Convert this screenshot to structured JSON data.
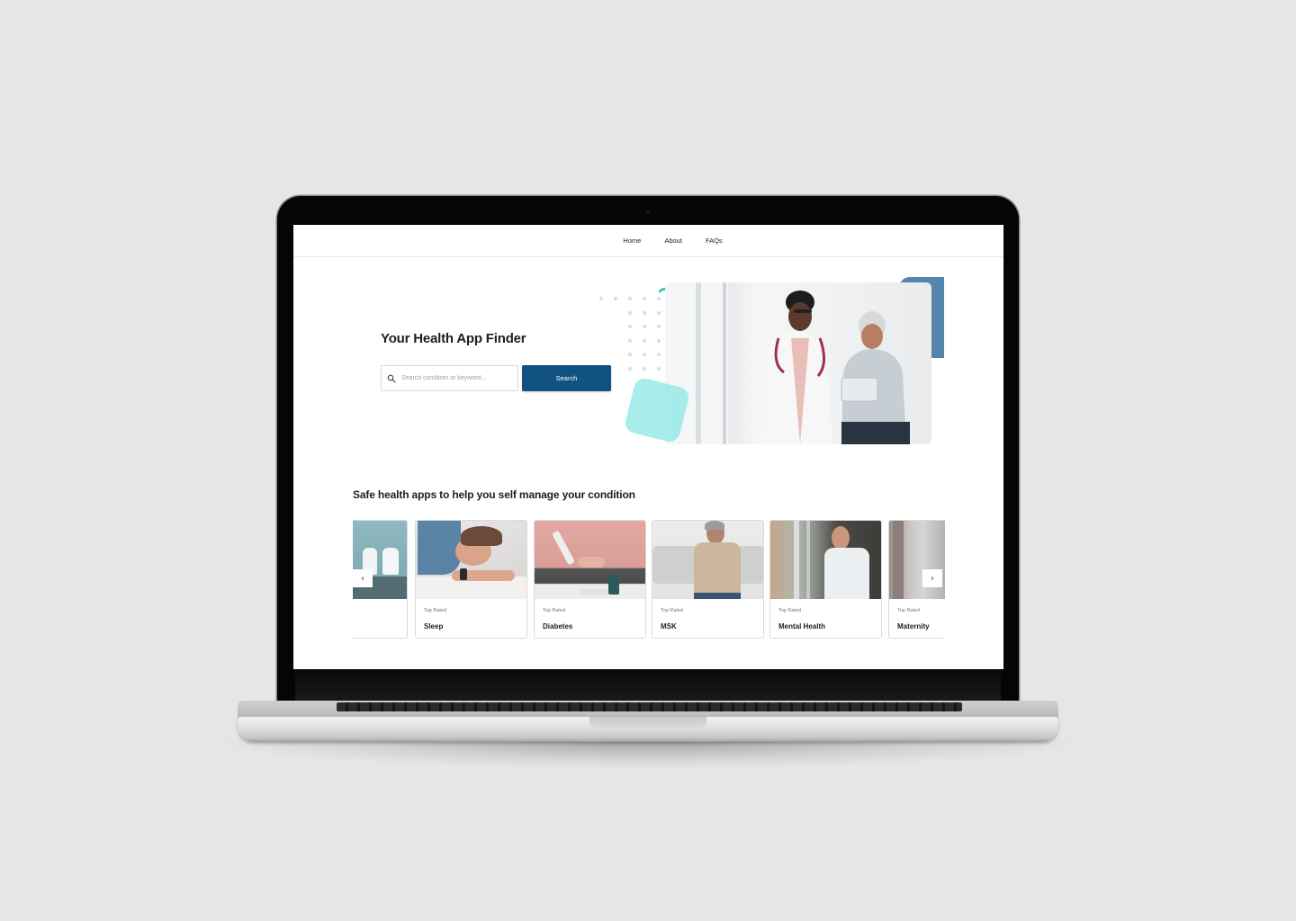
{
  "nav": {
    "items": [
      {
        "label": "Home"
      },
      {
        "label": "About"
      },
      {
        "label": "FAQs"
      }
    ]
  },
  "hero": {
    "title": "Your Health App Finder",
    "search_placeholder": "Search condition or keyword...",
    "search_value": "",
    "search_button": "Search",
    "search_icon": "search-icon",
    "image_alt": "Doctor showing a tablet to an elderly patient"
  },
  "section": {
    "title": "Safe health apps to help you self manage your condition",
    "cards": [
      {
        "tag": "",
        "name": "",
        "image": "waiting-room-chairs"
      },
      {
        "tag": "Top Rated",
        "name": "Sleep",
        "image": "woman-sleeping"
      },
      {
        "tag": "Top Rated",
        "name": "Diabetes",
        "image": "glucose-test"
      },
      {
        "tag": "Top Rated",
        "name": "MSK",
        "image": "man-shoulder-pain"
      },
      {
        "tag": "Top Rated",
        "name": "Mental Health",
        "image": "man-thinking-window"
      },
      {
        "tag": "Top Rated",
        "name": "Maternity",
        "image": "room-curtain"
      }
    ],
    "prev_arrow": "‹",
    "next_arrow": "›"
  },
  "colors": {
    "primary": "#125283",
    "accent_teal": "#86e6e3",
    "accent_blue": "#5584ad",
    "wave": "#3cbdb2",
    "background": "#e6e6e6"
  }
}
